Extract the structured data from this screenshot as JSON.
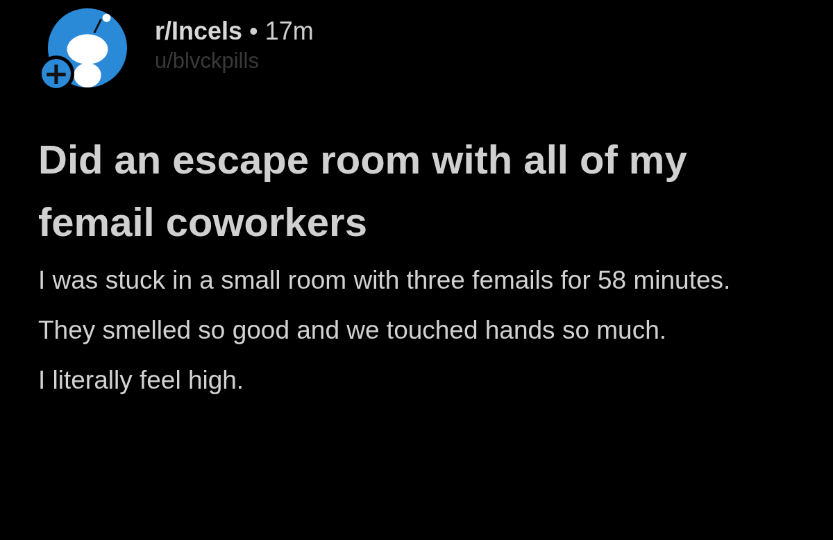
{
  "post": {
    "subreddit": "r/Incels",
    "separator": "•",
    "time": "17m",
    "author": "u/blvckpills",
    "join_button": {
      "label": "+"
    },
    "title": "Did an escape room with all of my femail coworkers",
    "paragraphs": [
      "I was stuck in a small room with three femails for 58 minutes.",
      "They smelled so good and we touched hands so much.",
      "I literally feel high."
    ]
  }
}
